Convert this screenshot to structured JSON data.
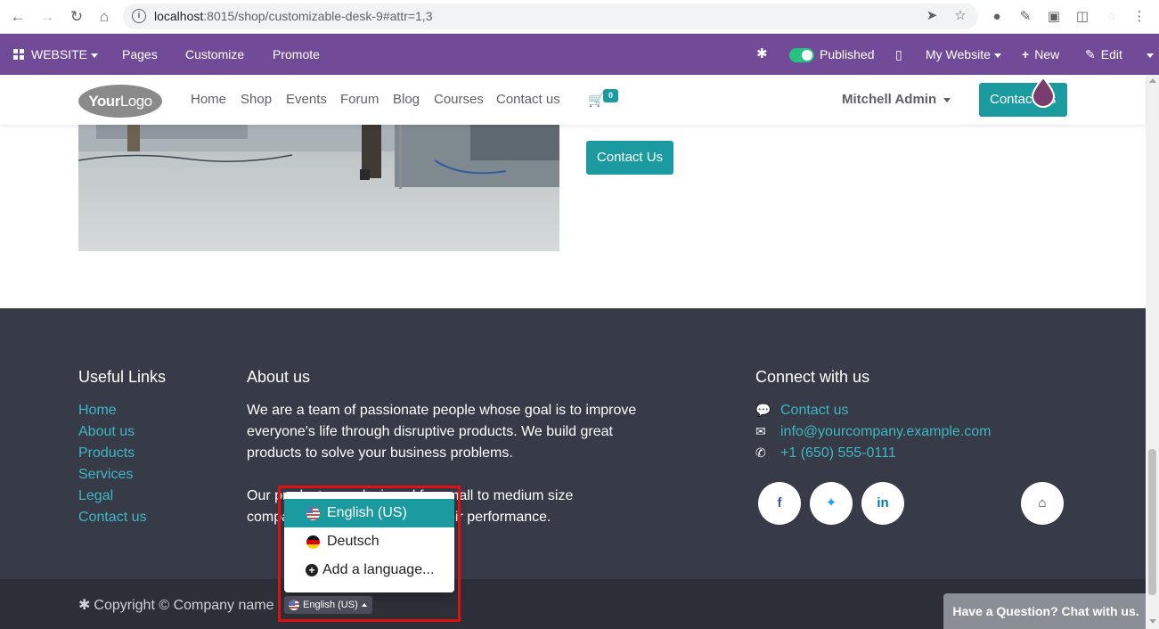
{
  "browser": {
    "url_host": "localhost",
    "url_rest": ":8015/shop/customizable-desk-9#attr=1,3"
  },
  "admin_bar": {
    "website_label": "WEBSITE",
    "pages": "Pages",
    "customize": "Customize",
    "promote": "Promote",
    "published": "Published",
    "my_website": "My Website",
    "new": "New",
    "edit": "Edit"
  },
  "header": {
    "logo_bold": "Your",
    "logo_light": "Logo",
    "menu": [
      "Home",
      "Shop",
      "Events",
      "Forum",
      "Blog",
      "Courses",
      "Contact us"
    ],
    "cart_count": "0",
    "user": "Mitchell Admin",
    "contact_button": "Contact Us"
  },
  "content": {
    "contact_button": "Contact Us"
  },
  "footer": {
    "useful_links_title": "Useful Links",
    "useful_links": [
      "Home",
      "About us",
      "Products",
      "Services",
      "Legal",
      "Contact us"
    ],
    "about_title": "About us",
    "about_lines": [
      "We are a team of passionate people whose goal is to improve",
      "everyone's life through disruptive products. We build great",
      "products to solve your business problems.",
      "Our products are designed for small to medium size",
      "companies willing to optimize their performance."
    ],
    "connect_title": "Connect with us",
    "connect_contact": "Contact us",
    "connect_email": "info@yourcompany.example.com",
    "connect_phone": "+1 (650) 555-0111",
    "copyright": "Copyright © Company name"
  },
  "language_menu": {
    "options": [
      "English (US)",
      "Deutsch"
    ],
    "add_language": "Add a language...",
    "current": "English (US)"
  },
  "chat": {
    "label": "Have a Question? Chat with us."
  },
  "colors": {
    "admin_bar": "#714b97",
    "primary": "#1b9aa0",
    "footer_bg": "#373a47",
    "link": "#3eb6c5",
    "highlight": "#e01010"
  }
}
